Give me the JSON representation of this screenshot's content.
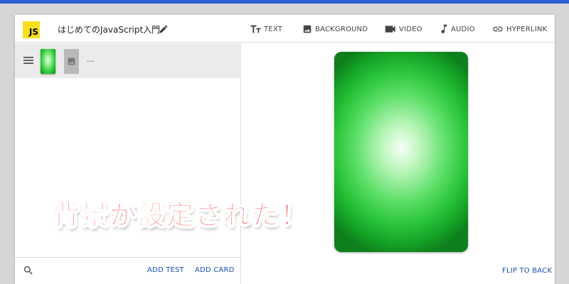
{
  "header": {
    "logo_text": "JS",
    "deck_title": "はじめてのJavaScript入門",
    "tools": [
      {
        "label": "TEXT",
        "icon": "text-format-icon"
      },
      {
        "label": "BACKGROUND",
        "icon": "image-icon"
      },
      {
        "label": "VIDEO",
        "icon": "video-camera-icon"
      },
      {
        "label": "AUDIO",
        "icon": "music-note-icon"
      },
      {
        "label": "HYPERLINK",
        "icon": "link-icon"
      }
    ]
  },
  "card_list": {
    "items": [
      {
        "text": "..."
      }
    ]
  },
  "footer": {
    "add_test": "ADD TEST",
    "add_card": "ADD CARD"
  },
  "preview": {
    "flip_label": "FLIP TO BACK"
  },
  "overlay": {
    "caption": "背景が設定された！"
  },
  "colors": {
    "accent": "#1a4fb3",
    "card_green": "#22c22f",
    "logo_yellow": "#f7df1e",
    "caption_red": "#ff6f6f"
  }
}
